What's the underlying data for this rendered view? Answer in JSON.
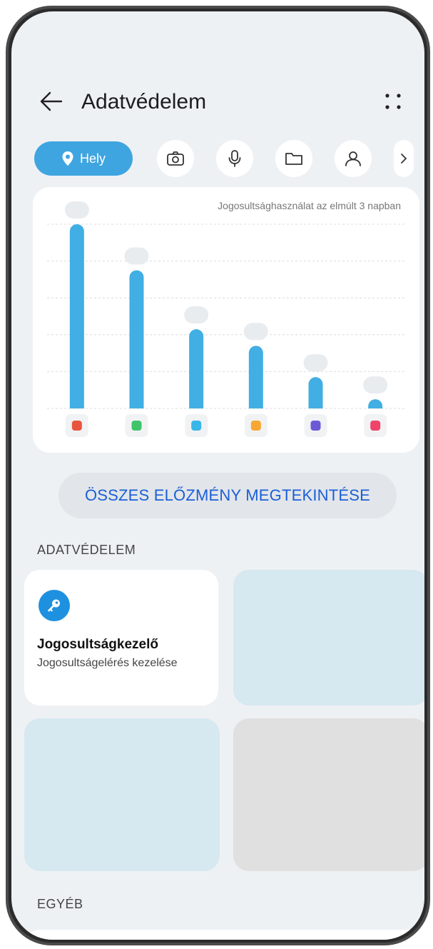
{
  "header": {
    "title": "Adatvédelem",
    "back_icon": "arrow-left-icon",
    "more_icon": "more-dots-icon"
  },
  "tabs": {
    "active_label": "Hely",
    "items": [
      "location-pin-icon",
      "camera-icon",
      "microphone-icon",
      "folder-icon",
      "contacts-icon",
      "chevron-right-icon"
    ]
  },
  "chart_data": {
    "type": "bar",
    "title": "Jogosultsághasználat az elmúlt 3 napban",
    "categories": [
      "maps-app-icon",
      "community-app-icon",
      "messaging-app-icon",
      "weather-app-icon",
      "video-app-icon",
      "shopping-app-icon"
    ],
    "values": [
      100,
      75,
      43,
      34,
      17,
      5
    ],
    "ylim": [
      0,
      100
    ],
    "grid": true,
    "bar_color": "#41aee4"
  },
  "history_button": {
    "label": "ÖSSZES ELŐZMÉNY MEGTEKINTÉSE"
  },
  "sections": {
    "privacy_label": "ADATVÉDELEM",
    "other_label": "EGYÉB"
  },
  "permission_tile": {
    "icon": "key-icon",
    "title": "Jogosultságkezelő",
    "subtitle": "Jogosultságelérés kezelése"
  },
  "colors": {
    "accent": "#3fa5e0",
    "link": "#1a5fd8",
    "background": "#eef1f4"
  }
}
